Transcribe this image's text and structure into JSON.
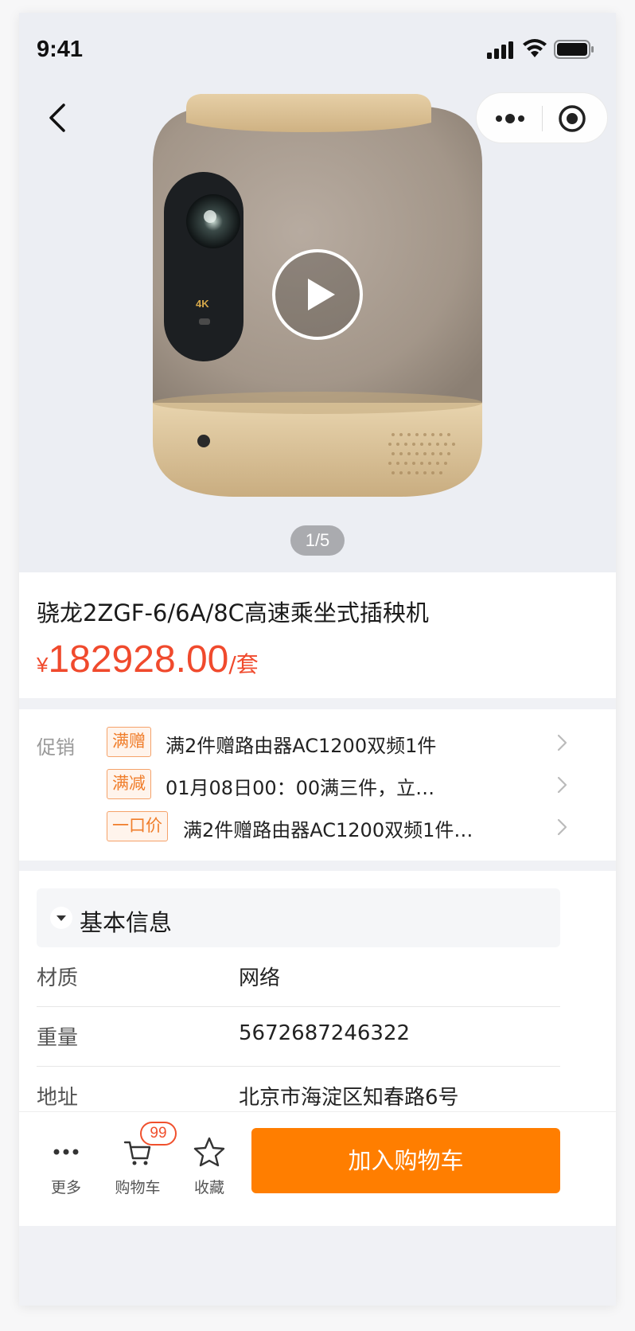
{
  "status_bar": {
    "time": "9:41"
  },
  "gallery": {
    "pager": "1/5"
  },
  "product": {
    "title": "骁龙2ZGF-6/6A/8C高速乘坐式插秧机",
    "currency": "¥",
    "price": "182928.00",
    "unit": "/套"
  },
  "promotions": {
    "label": "促销",
    "items": [
      {
        "tag": "满赠",
        "text": "满2件赠路由器AC1200双频1件"
      },
      {
        "tag": "满减",
        "text": "01月08日00：00满三件，立…"
      },
      {
        "tag": "一口价",
        "text": "满2件赠路由器AC1200双频1件…"
      }
    ]
  },
  "basic_info": {
    "title": "基本信息",
    "rows": [
      {
        "key": "材质",
        "value": "网络"
      },
      {
        "key": "重量",
        "value": "5672687246322"
      },
      {
        "key": "地址",
        "value": "北京市海淀区知春路6号"
      }
    ]
  },
  "bottom_bar": {
    "more_label": "更多",
    "cart_label": "购物车",
    "cart_badge": "99",
    "favorite_label": "收藏",
    "add_to_cart": "加入购物车"
  },
  "colors": {
    "price": "#f04a2d",
    "primary_button": "#ff7e00",
    "tag_border": "#f5a26a",
    "tag_text": "#f07d2a"
  },
  "icons": [
    "back-icon",
    "more-dots-icon",
    "target-icon",
    "play-icon",
    "chevron-right-icon",
    "caret-down-icon",
    "cart-icon",
    "star-icon",
    "signal-icon",
    "wifi-icon",
    "battery-icon"
  ]
}
